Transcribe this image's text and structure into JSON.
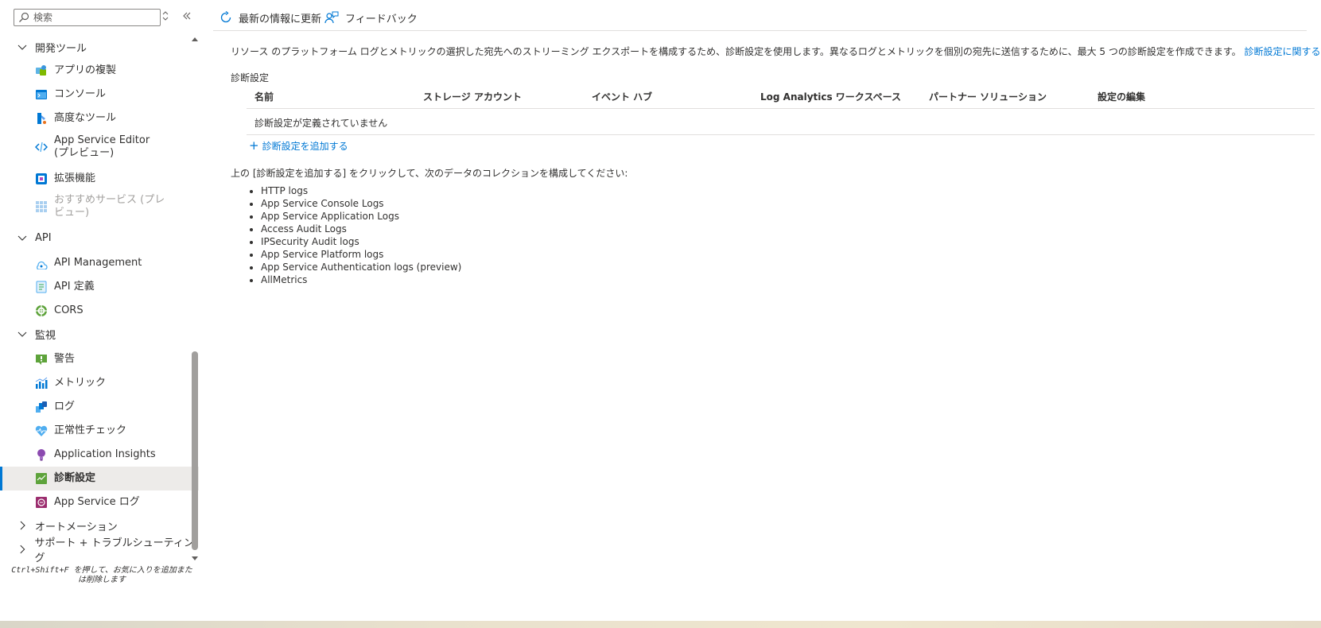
{
  "sidebar": {
    "search_placeholder": "検索",
    "groups": {
      "dev_tools": "開発ツール",
      "api": "API",
      "monitoring": "監視",
      "automation": "オートメーション",
      "support": "サポート + トラブルシューティング"
    },
    "items": {
      "clone_app": "アプリの複製",
      "console": "コンソール",
      "advanced_tools": "高度なツール",
      "app_service_editor": "App Service Editor (プレビュー)",
      "extensions": "拡張機能",
      "recommended_services": "おすすめサービス (プレビュー)",
      "api_management": "API Management",
      "api_definition": "API 定義",
      "cors": "CORS",
      "alerts": "警告",
      "metrics": "メトリック",
      "logs": "ログ",
      "health_check": "正常性チェック",
      "app_insights": "Application Insights",
      "diag_settings": "診断設定",
      "app_service_logs": "App Service ログ"
    },
    "hint": "Ctrl+Shift+F を押して、お気に入りを追加または削除します"
  },
  "toolbar": {
    "refresh_label": "最新の情報に更新",
    "feedback_label": "フィードバック"
  },
  "main": {
    "description": "リソース のプラットフォーム ログとメトリックの選択した宛先へのストリーミング エクスポートを構成するため、診断設定を使用します。異なるログとメトリックを個別の宛先に送信するために、最大 5 つの診断設定を作成できます。",
    "learn_more": "診断設定に関する詳細情報",
    "section_title": "診断設定",
    "table": {
      "headers": [
        "名前",
        "ストレージ アカウント",
        "イベント ハブ",
        "Log Analytics ワークスペース",
        "パートナー ソリューション",
        "設定の編集"
      ],
      "empty_message": "診断設定が定義されていません"
    },
    "add_link": "診断設定を追加する",
    "instructions": "上の [診断設定を追加する] をクリックして、次のデータのコレクションを構成してください:",
    "categories": [
      "HTTP logs",
      "App Service Console Logs",
      "App Service Application Logs",
      "Access Audit Logs",
      "IPSecurity Audit logs",
      "App Service Platform logs",
      "App Service Authentication logs (preview)",
      "AllMetrics"
    ]
  },
  "colors": {
    "accent": "#0078d4",
    "selected_bg": "#edebe9"
  }
}
